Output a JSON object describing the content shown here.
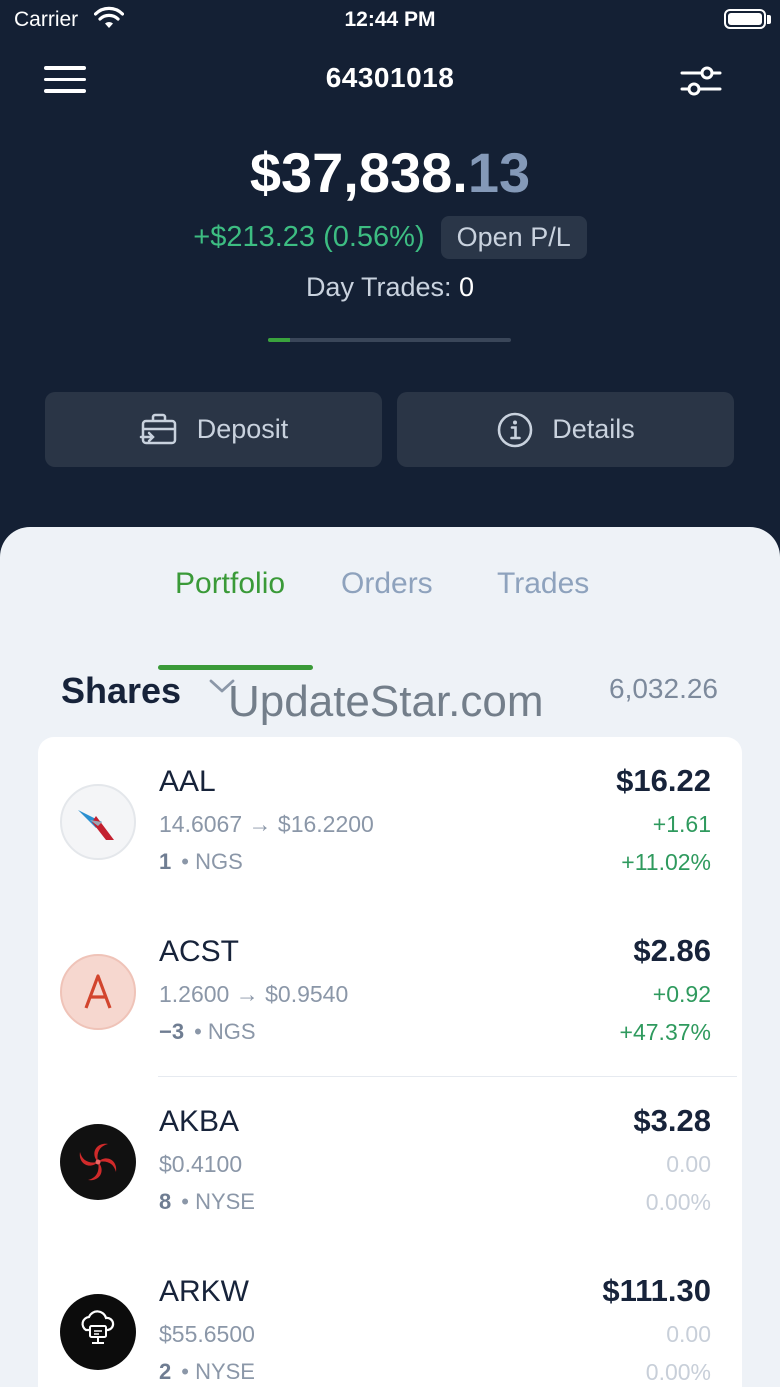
{
  "status_bar": {
    "carrier": "Carrier",
    "time": "12:44 PM"
  },
  "header": {
    "account_number": "64301018"
  },
  "balance": {
    "whole": "$37,838.",
    "cents": "13"
  },
  "pl": {
    "value": "+$213.23 (0.56%)",
    "badge": "Open P/L"
  },
  "day_trades": {
    "label": "Day Trades:",
    "value": "0"
  },
  "progress_fraction": 0.09,
  "actions": {
    "deposit": "Deposit",
    "details": "Details"
  },
  "tabs": [
    {
      "label": "Portfolio",
      "active": true
    },
    {
      "label": "Orders",
      "active": false
    },
    {
      "label": "Trades",
      "active": false
    }
  ],
  "section": {
    "title": "Shares",
    "total": "6,032.26"
  },
  "watermark": "UpdateStar.com",
  "positions": [
    {
      "symbol": "AAL",
      "price_line": "14.6067 → $16.2200",
      "qty": "1",
      "exchange": "• NGS",
      "price": "$16.22",
      "change": "+1.61",
      "change_pct": "+11.02%",
      "logo": "airline-logo"
    },
    {
      "symbol": "ACST",
      "price_line": "1.2600 → $0.9540",
      "qty": "−3",
      "exchange": "• NGS",
      "price": "$2.86",
      "change": "+0.92",
      "change_pct": "+47.37%",
      "logo": "letter-a-logo"
    },
    {
      "symbol": "AKBA",
      "price_line": "$0.4100",
      "qty": "8",
      "exchange": "• NYSE",
      "price": "$3.28",
      "change": "0.00",
      "change_pct": "0.00%",
      "logo": "spiral-logo"
    },
    {
      "symbol": "ARKW",
      "price_line": "$55.6500",
      "qty": "2",
      "exchange": "• NYSE",
      "price": "$111.30",
      "change": "0.00",
      "change_pct": "0.00%",
      "logo": "cloud-computer-logo"
    }
  ],
  "colors": {
    "background": "#142034",
    "accent_green": "#3a9a38",
    "gain": "#2f9a5e",
    "sheet": "#eef2f7"
  }
}
